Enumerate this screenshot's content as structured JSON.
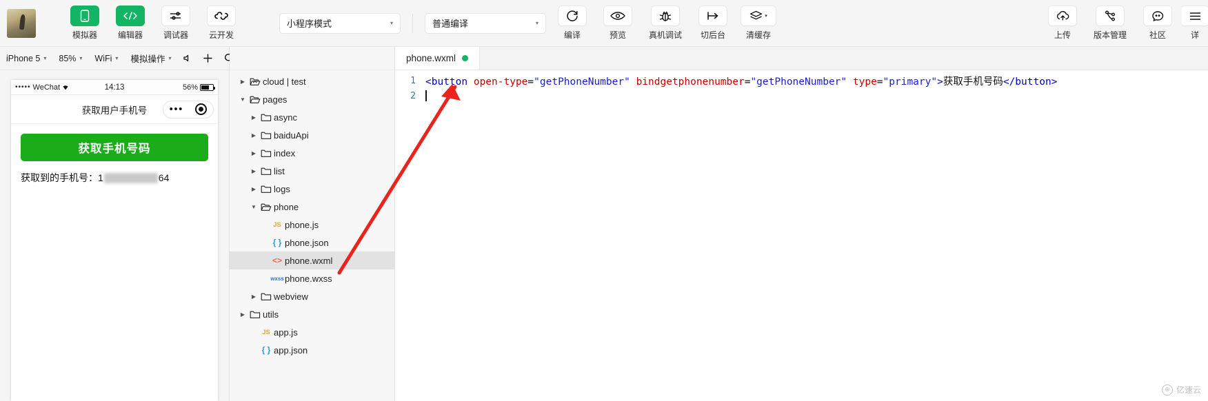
{
  "toolbar": {
    "avatar_name": "project-avatar",
    "items": [
      {
        "label": "模拟器",
        "icon": "phone-icon",
        "active": true
      },
      {
        "label": "编辑器",
        "icon": "code-icon",
        "active": true
      },
      {
        "label": "调试器",
        "icon": "sliders-icon",
        "active": false
      },
      {
        "label": "云开发",
        "icon": "cloud-dev-icon",
        "active": false
      }
    ],
    "mode_select": {
      "value": "小程序模式",
      "caret": "▾"
    },
    "compile_select": {
      "value": "普通编译",
      "caret": "▾"
    },
    "actions": [
      {
        "label": "编译",
        "icon": "refresh-icon"
      },
      {
        "label": "预览",
        "icon": "eye-icon"
      },
      {
        "label": "真机调试",
        "icon": "bug-icon"
      },
      {
        "label": "切后台",
        "icon": "background-icon"
      },
      {
        "label": "清缓存",
        "icon": "layers-icon",
        "has_caret": true
      }
    ],
    "right_actions": [
      {
        "label": "上传",
        "icon": "upload-cloud-icon"
      },
      {
        "label": "版本管理",
        "icon": "branch-icon"
      },
      {
        "label": "社区",
        "icon": "chat-icon"
      },
      {
        "label": "详",
        "icon": "menu-icon"
      }
    ]
  },
  "simulator": {
    "toolbar": {
      "device": "iPhone 5",
      "zoom": "85%",
      "network": "WiFi",
      "simulate": "模拟操作",
      "caret": "▾",
      "icons": [
        "volume-icon",
        "plus-icon",
        "search-icon",
        "more-icon",
        "align-icon",
        "panel-icon"
      ]
    },
    "phone": {
      "status_bar": {
        "carrier": "WeChat",
        "signal_dots": "•••••",
        "wifi": "wifi-icon",
        "time": "14:13",
        "battery": "56%"
      },
      "nav_title": "获取用户手机号",
      "capsule": {
        "more": "•••",
        "target": "target-icon"
      },
      "button_label": "获取手机号码",
      "result_prefix": "获取到的手机号：1",
      "result_suffix": "64"
    }
  },
  "file_tree": [
    {
      "label": "cloud | test",
      "indent": 0,
      "type": "folder-cloud",
      "arrow": "▶",
      "selected": false
    },
    {
      "label": "pages",
      "indent": 0,
      "type": "folder-open",
      "arrow": "▼",
      "selected": false
    },
    {
      "label": "async",
      "indent": 1,
      "type": "folder",
      "arrow": "▶",
      "selected": false
    },
    {
      "label": "baiduApi",
      "indent": 1,
      "type": "folder",
      "arrow": "▶",
      "selected": false
    },
    {
      "label": "index",
      "indent": 1,
      "type": "folder",
      "arrow": "▶",
      "selected": false
    },
    {
      "label": "list",
      "indent": 1,
      "type": "folder",
      "arrow": "▶",
      "selected": false
    },
    {
      "label": "logs",
      "indent": 1,
      "type": "folder",
      "arrow": "▶",
      "selected": false
    },
    {
      "label": "phone",
      "indent": 1,
      "type": "folder-open",
      "arrow": "▼",
      "selected": false
    },
    {
      "label": "phone.js",
      "indent": 2,
      "type": "file-js",
      "arrow": "",
      "selected": false
    },
    {
      "label": "phone.json",
      "indent": 2,
      "type": "file-json",
      "arrow": "",
      "selected": false
    },
    {
      "label": "phone.wxml",
      "indent": 2,
      "type": "file-wxml",
      "arrow": "",
      "selected": true
    },
    {
      "label": "phone.wxss",
      "indent": 2,
      "type": "file-wxss",
      "arrow": "",
      "selected": false
    },
    {
      "label": "webview",
      "indent": 1,
      "type": "folder",
      "arrow": "▶",
      "selected": false
    },
    {
      "label": "utils",
      "indent": 0,
      "type": "folder",
      "arrow": "▶",
      "selected": false
    },
    {
      "label": "app.js",
      "indent": 1,
      "type": "file-js",
      "arrow": "",
      "selected": false
    },
    {
      "label": "app.json",
      "indent": 1,
      "type": "file-json",
      "arrow": "",
      "selected": false
    }
  ],
  "editor": {
    "tab": {
      "name": "phone.wxml",
      "dirty": true
    },
    "lines": [
      {
        "number": "1",
        "tokens": [
          {
            "text": "<button",
            "type": "tag"
          },
          {
            "text": " ",
            "type": "plain"
          },
          {
            "text": "open-type",
            "type": "attr"
          },
          {
            "text": "=",
            "type": "eq"
          },
          {
            "text": "\"getPhoneNumber\"",
            "type": "str"
          },
          {
            "text": " ",
            "type": "plain"
          },
          {
            "text": "bindgetphonenumber",
            "type": "attr"
          },
          {
            "text": "=",
            "type": "eq"
          },
          {
            "text": "\"getPhoneNumber\"",
            "type": "str"
          },
          {
            "text": " ",
            "type": "plain"
          },
          {
            "text": "type",
            "type": "attr"
          },
          {
            "text": "=",
            "type": "eq"
          },
          {
            "text": "\"primary\"",
            "type": "str"
          },
          {
            "text": ">",
            "type": "tag"
          },
          {
            "text": "获取手机号码",
            "type": "text"
          },
          {
            "text": "</button>",
            "type": "tag"
          }
        ]
      },
      {
        "number": "2",
        "tokens": []
      }
    ]
  },
  "annotation": {
    "color": "#e8241d",
    "name": "red-arrow-annotation"
  },
  "watermark": {
    "text": "亿速云",
    "logo": "globe-icon"
  }
}
